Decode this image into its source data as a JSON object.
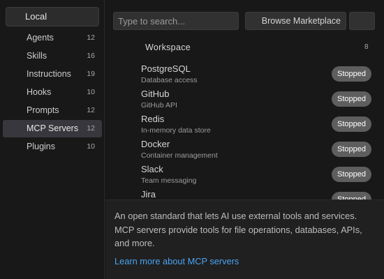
{
  "sidebar": {
    "scope_label": "Local",
    "items": [
      {
        "label": "Agents",
        "count": "12"
      },
      {
        "label": "Skills",
        "count": "16"
      },
      {
        "label": "Instructions",
        "count": "19"
      },
      {
        "label": "Hooks",
        "count": "10"
      },
      {
        "label": "Prompts",
        "count": "12"
      },
      {
        "label": "MCP Servers",
        "count": "12",
        "active": true
      },
      {
        "label": "Plugins",
        "count": "10"
      }
    ]
  },
  "toolbar": {
    "search_placeholder": "Type to search...",
    "browse_label": "Browse Marketplace"
  },
  "workspace": {
    "title": "Workspace",
    "count": "8"
  },
  "servers": [
    {
      "name": "PostgreSQL",
      "description": "Database access",
      "status": "Stopped"
    },
    {
      "name": "GitHub",
      "description": "GitHub API",
      "status": "Stopped"
    },
    {
      "name": "Redis",
      "description": "In-memory data store",
      "status": "Stopped"
    },
    {
      "name": "Docker",
      "description": "Container management",
      "status": "Stopped"
    },
    {
      "name": "Slack",
      "description": "Team messaging",
      "status": "Stopped"
    },
    {
      "name": "Jira",
      "description": "",
      "status": "Stopped"
    }
  ],
  "info": {
    "text": "An open standard that lets AI use external tools and services. MCP servers provide tools for file operations, databases, APIs, and more.",
    "link": "Learn more about MCP servers"
  },
  "colors": {
    "background": "#181818",
    "active_item": "#37373d",
    "status_badge": "#5e5e5e",
    "link": "#4aa3f2"
  }
}
